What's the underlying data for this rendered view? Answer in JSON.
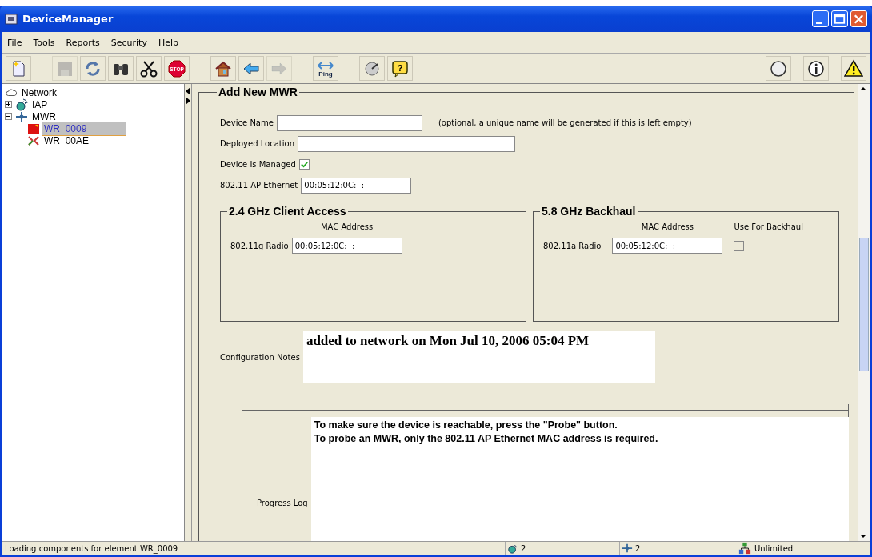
{
  "window": {
    "title": "DeviceManager"
  },
  "menu": [
    "File",
    "Tools",
    "Reports",
    "Security",
    "Help"
  ],
  "toolbar": {
    "left": [
      {
        "kind": "new",
        "disabled": false
      },
      {
        "kind": "gap"
      },
      {
        "kind": "save",
        "disabled": true
      },
      {
        "kind": "refresh",
        "disabled": false
      },
      {
        "kind": "find",
        "disabled": false
      },
      {
        "kind": "cut",
        "disabled": false
      },
      {
        "kind": "stop",
        "disabled": false,
        "label": "STOP"
      },
      {
        "kind": "gap"
      },
      {
        "kind": "home",
        "disabled": false
      },
      {
        "kind": "back",
        "disabled": false
      },
      {
        "kind": "forward",
        "disabled": true
      },
      {
        "kind": "gap"
      },
      {
        "kind": "ping",
        "disabled": false,
        "label": "Ping"
      },
      {
        "kind": "gap"
      },
      {
        "kind": "gauge",
        "disabled": false
      },
      {
        "kind": "help",
        "disabled": false,
        "label": "?"
      }
    ],
    "right": [
      {
        "kind": "circle",
        "disabled": false
      },
      {
        "kind": "info",
        "disabled": false
      },
      {
        "kind": "warning",
        "disabled": false
      }
    ]
  },
  "tree": {
    "label": "Network",
    "children": [
      {
        "label": "IAP",
        "kind": "iap",
        "expanded": false,
        "selected": false
      },
      {
        "label": "MWR",
        "kind": "mwr",
        "expanded": true,
        "selected": false,
        "children": [
          {
            "label": "WR_0009",
            "kind": "red",
            "selected": true
          },
          {
            "label": "WR_00AE",
            "kind": "arrows",
            "selected": false
          }
        ]
      }
    ]
  },
  "form": {
    "title": "Add New MWR",
    "device_name": {
      "label": "Device Name",
      "hint": "(optional, a unique name will be generated if this is left empty)"
    },
    "deployed_location": {
      "label": "Deployed Location"
    },
    "managed": {
      "label": "Device Is Managed",
      "checked": true
    },
    "ap_ethernet": {
      "label": "802.11 AP Ethernet",
      "value": "00:05:12:0C:  :"
    },
    "client_access": {
      "title": "2.4 GHz Client Access",
      "column": "MAC Address",
      "radio_label": "802.11g Radio",
      "value": "00:05:12:0C:  :"
    },
    "backhaul": {
      "title": "5.8 GHz Backhaul",
      "column": "MAC Address",
      "use_column": "Use For Backhaul",
      "radio_label": "802.11a Radio",
      "value": "00:05:12:0C:  :",
      "use_for_backhaul": false
    },
    "notes": {
      "label": "Configuration Notes",
      "value": "added to network on Mon Jul 10, 2006 05:04 PM"
    },
    "progress": {
      "label": "Progress Log",
      "lines": [
        "To make sure the device is reachable, press the \"Probe\" button.",
        "To probe an MWR, only the 802.11 AP Ethernet MAC address is required."
      ]
    }
  },
  "status_bar": {
    "message": "Loading components for element WR_0009",
    "iap_count": "2",
    "mwr_count": "2",
    "license": "Unlimited"
  }
}
